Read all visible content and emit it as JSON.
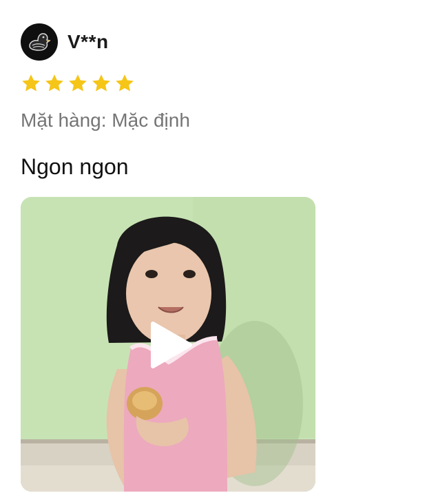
{
  "reviewer": {
    "name": "V**n",
    "avatar_icon": "duck-logo-icon"
  },
  "rating": {
    "value": 5,
    "max": 5,
    "star_color": "#f5c518"
  },
  "variant": {
    "text": "Mặt hàng: Mặc định"
  },
  "comment": {
    "text": "Ngon ngon"
  },
  "media": {
    "type": "video",
    "play_icon": "play-icon"
  }
}
